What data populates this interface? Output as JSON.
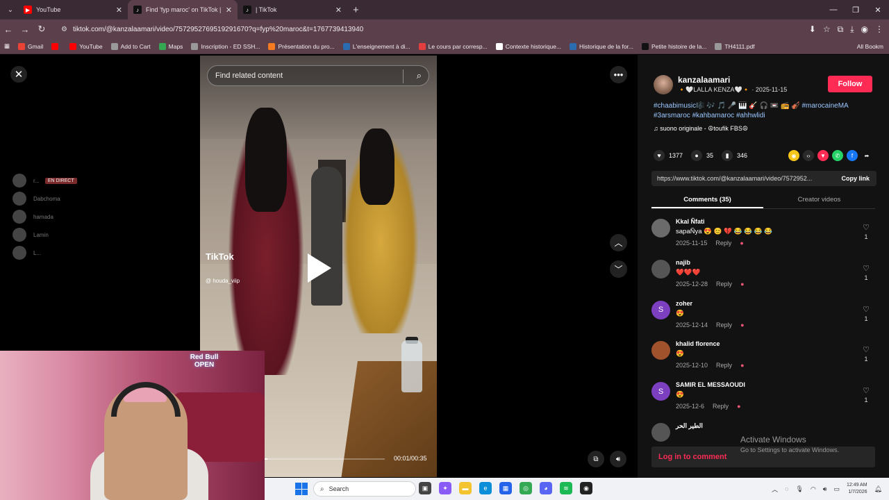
{
  "browser": {
    "tabs": [
      {
        "label": "YouTube",
        "favicon_color": "#ff0000",
        "active": false
      },
      {
        "label": "Find 'fyp maroc' on TikTok | Tik",
        "favicon_color": "#111111",
        "active": true
      },
      {
        "label": "| TikTok",
        "favicon_color": "#111111",
        "active": false
      }
    ],
    "url": "tiktok.com/@kanzalaamari/video/7572952769519291670?q=fyp%20maroc&t=1767739413940",
    "bookmarks": [
      {
        "label": "Gmail",
        "icon": "mail-icon",
        "color": "#ea4335"
      },
      {
        "label": "",
        "icon": "youtube-icon",
        "color": "#ff0000"
      },
      {
        "label": "YouTube",
        "icon": "youtube-icon",
        "color": "#ff0000"
      },
      {
        "label": "Add to Cart",
        "icon": "cart-icon",
        "color": "#999999"
      },
      {
        "label": "Maps",
        "icon": "maps-icon",
        "color": "#34a853"
      },
      {
        "label": "Inscription - ED SSH...",
        "icon": "globe-icon",
        "color": "#999999"
      },
      {
        "label": "Présentation du pro...",
        "icon": "doc-icon",
        "color": "#f47b20"
      },
      {
        "label": "L'enseignement à di...",
        "icon": "doc-icon",
        "color": "#2b6cb0"
      },
      {
        "label": "Le cours par corresp...",
        "icon": "doc-icon",
        "color": "#e53e3e"
      },
      {
        "label": "Contexte historique...",
        "icon": "doc-icon",
        "color": "#ffffff"
      },
      {
        "label": "Historique de la for...",
        "icon": "doc-icon",
        "color": "#2b6cb0"
      },
      {
        "label": "Petite histoire de la...",
        "icon": "doc-icon",
        "color": "#111111"
      },
      {
        "label": "TH4111.pdf",
        "icon": "globe-icon",
        "color": "#999999"
      }
    ],
    "all_bookmarks": "All Bookm"
  },
  "player": {
    "search_placeholder": "Find related content",
    "watermark_logo": "TikTok",
    "watermark_user": "@ houda_viip",
    "time": "00:01/00:35",
    "progress": 0.03
  },
  "overlay_list": [
    {
      "name": "r...",
      "badge": "EN DIRECT"
    },
    {
      "name": "Dabchoma",
      "badge": ""
    },
    {
      "name": "hamada",
      "badge": ""
    },
    {
      "name": "Lamin",
      "badge": ""
    },
    {
      "name": "L...",
      "badge": ""
    }
  ],
  "webcam": {
    "neon_line1": "Red Bull",
    "neon_line2": "OPEN"
  },
  "post": {
    "author": "kanzalaamari",
    "meta": "🔸🤍LALLA KENZA🤍🔸 · 2025-11-15",
    "follow_label": "Follow",
    "description": "#chaabimusic🎼 🎶 🎵 🎤 🎹 🎸 🎧 📼 📻 🎻 #marocaineMA #3arsmaroc #kahbamaroc #ahhwlidi",
    "sound": "♫  suono originale - ☮toufik FBS☮",
    "likes": "1377",
    "comments_count": "35",
    "saves": "346",
    "link": "https://www.tiktok.com/@kanzalaamari/video/7572952...",
    "copy_label": "Copy link",
    "tab_comments": "Comments (35)",
    "tab_creator": "Creator videos",
    "share_colors": [
      "#f5c518",
      "#2a2a2a",
      "#fe2c55",
      "#25d366",
      "#1877f2"
    ]
  },
  "comments": [
    {
      "user": "Kkal Ñfati",
      "text": "sapaÑya 😍 😊 💔 😂 😂 😂 😂",
      "date": "2025-11-15",
      "likes": "1",
      "avatar": "#6b6b6b",
      "initial": ""
    },
    {
      "user": "najib",
      "text": "❤️❤️❤️",
      "date": "2025-12-28",
      "likes": "1",
      "avatar": "#555555",
      "initial": ""
    },
    {
      "user": "zoher",
      "text": "😍",
      "date": "2025-12-14",
      "likes": "1",
      "avatar": "#7b3fbf",
      "initial": "S"
    },
    {
      "user": "khalid florence",
      "text": "😍",
      "date": "2025-12-10",
      "likes": "1",
      "avatar": "#a0522d",
      "initial": ""
    },
    {
      "user": "SAMIR EL MESSAOUDI",
      "text": "😍",
      "date": "2025-12-6",
      "likes": "1",
      "avatar": "#7b3fbf",
      "initial": "S"
    },
    {
      "user": "الطير الحر",
      "text": "",
      "date": "",
      "likes": "",
      "avatar": "#555555",
      "initial": ""
    }
  ],
  "reply_label": "Reply",
  "login_label": "Log in to comment",
  "activate": {
    "title": "Activate Windows",
    "sub": "Go to Settings to activate Windows."
  },
  "taskbar": {
    "search_label": "Search",
    "time": "12:49 AM",
    "date": "1/7/2026"
  }
}
